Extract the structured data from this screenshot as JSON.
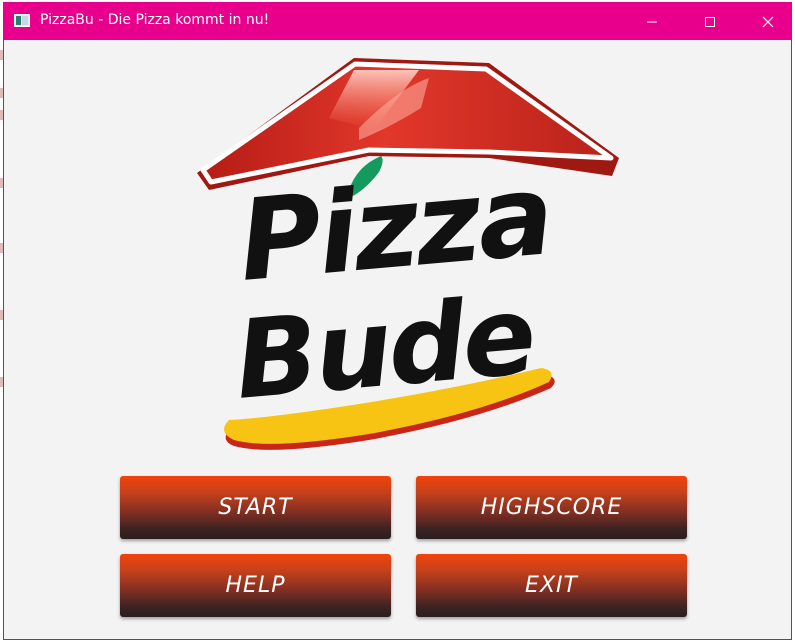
{
  "window": {
    "title": "PizzaBu - Die Pizza kommt in nu!"
  },
  "logo": {
    "line1": "Pizza",
    "line2": "Bude",
    "icon": "pizza-hut-roof-logo",
    "colors": {
      "roof": "#d93322",
      "text": "#111111",
      "swoosh": "#f7c21a",
      "dot": "#1a9a5a"
    }
  },
  "buttons": {
    "start": "START",
    "highscore": "HIGHSCORE",
    "help": "HELP",
    "exit": "EXIT"
  },
  "colors": {
    "titlebar": "#e8008c",
    "button_top": "#f1430c",
    "button_bottom": "#2a1f20",
    "background": "#f3f3f3"
  }
}
